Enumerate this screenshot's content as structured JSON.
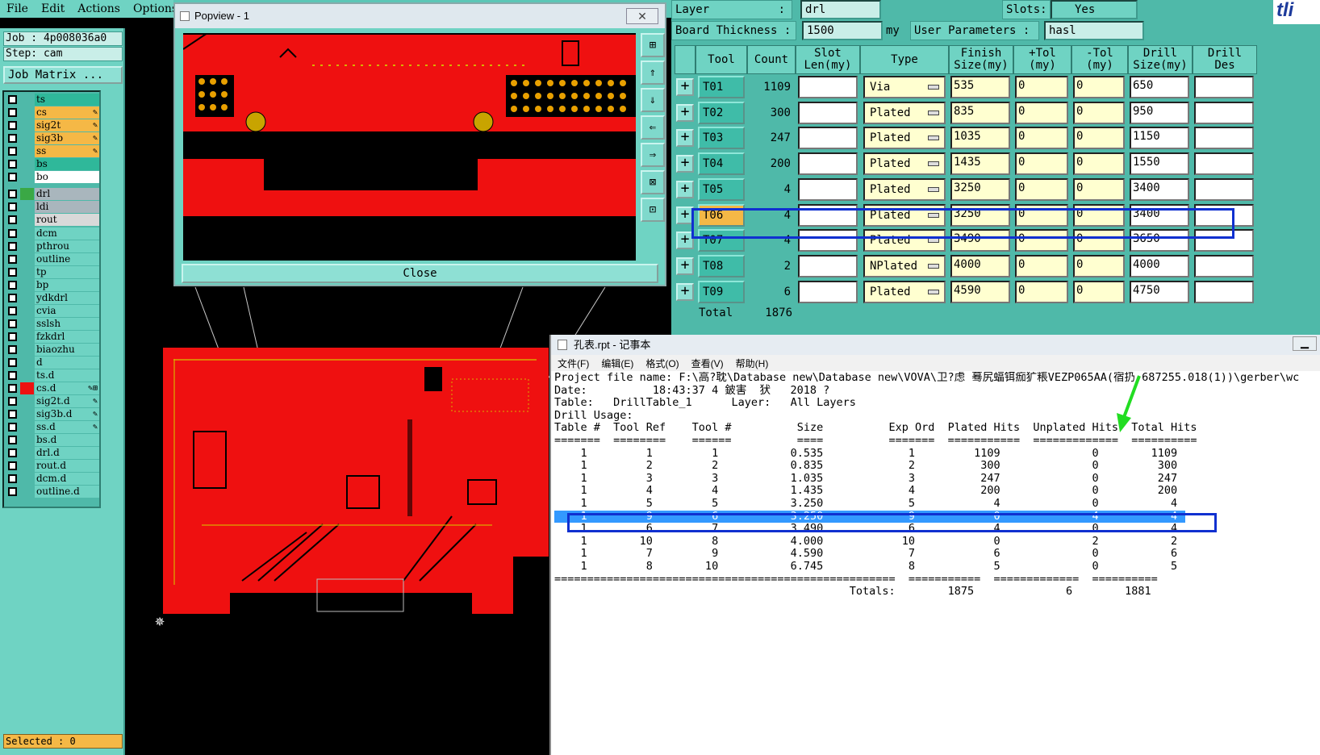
{
  "menubar": {
    "items": [
      "File",
      "Edit",
      "Actions",
      "Options"
    ]
  },
  "leftpanel": {
    "job": "Job : 4p008036a0",
    "step": "Step: cam",
    "job_matrix": "Job Matrix ...",
    "selected": "Selected : 0",
    "layers": [
      {
        "name": "ts",
        "color": "#2fb89a",
        "swatch": "#4fb9a9",
        "mark": ""
      },
      {
        "name": "cs",
        "color": "#f5b846",
        "swatch": "#4fb9a9",
        "mark": "✎"
      },
      {
        "name": "sig2t",
        "color": "#f5b846",
        "swatch": "#4fb9a9",
        "mark": "✎"
      },
      {
        "name": "sig3b",
        "color": "#f5b846",
        "swatch": "#4fb9a9",
        "mark": "✎"
      },
      {
        "name": "ss",
        "color": "#f5b846",
        "swatch": "#4fb9a9",
        "mark": "✎"
      },
      {
        "name": "bs",
        "color": "#2fb89a",
        "swatch": "#4fb9a9",
        "mark": ""
      },
      {
        "name": "bo",
        "color": "#ffffff",
        "swatch": "#4fb9a9",
        "mark": ""
      },
      {
        "name": "drl",
        "color": "#a9b6bd",
        "swatch": "#3aa845",
        "mark": ""
      },
      {
        "name": "ldi",
        "color": "#a9b6bd",
        "swatch": "#4fb9a9",
        "mark": ""
      },
      {
        "name": "rout",
        "color": "#d9d9d9",
        "swatch": "#4fb9a9",
        "mark": ""
      },
      {
        "name": "dcm",
        "color": "#6fd3c3",
        "swatch": "#4fb9a9",
        "mark": ""
      },
      {
        "name": "pthrou",
        "color": "#6fd3c3",
        "swatch": "#4fb9a9",
        "mark": ""
      },
      {
        "name": "outline",
        "color": "#6fd3c3",
        "swatch": "#4fb9a9",
        "mark": ""
      },
      {
        "name": "tp",
        "color": "#6fd3c3",
        "swatch": "#4fb9a9",
        "mark": ""
      },
      {
        "name": "bp",
        "color": "#6fd3c3",
        "swatch": "#4fb9a9",
        "mark": ""
      },
      {
        "name": "ydkdrl",
        "color": "#6fd3c3",
        "swatch": "#4fb9a9",
        "mark": ""
      },
      {
        "name": "cvia",
        "color": "#6fd3c3",
        "swatch": "#4fb9a9",
        "mark": ""
      },
      {
        "name": "sslsh",
        "color": "#6fd3c3",
        "swatch": "#4fb9a9",
        "mark": ""
      },
      {
        "name": "fzkdrl",
        "color": "#6fd3c3",
        "swatch": "#4fb9a9",
        "mark": ""
      },
      {
        "name": "biaozhu",
        "color": "#6fd3c3",
        "swatch": "#4fb9a9",
        "mark": ""
      },
      {
        "name": "d",
        "color": "#6fd3c3",
        "swatch": "#4fb9a9",
        "mark": ""
      },
      {
        "name": "ts.d",
        "color": "#6fd3c3",
        "swatch": "#4fb9a9",
        "mark": ""
      },
      {
        "name": "cs.d",
        "color": "#6fd3c3",
        "swatch": "#ee1111",
        "mark": "✎⊞"
      },
      {
        "name": "sig2t.d",
        "color": "#6fd3c3",
        "swatch": "#4fb9a9",
        "mark": "✎"
      },
      {
        "name": "sig3b.d",
        "color": "#6fd3c3",
        "swatch": "#4fb9a9",
        "mark": "✎"
      },
      {
        "name": "ss.d",
        "color": "#6fd3c3",
        "swatch": "#4fb9a9",
        "mark": "✎"
      },
      {
        "name": "bs.d",
        "color": "#6fd3c3",
        "swatch": "#4fb9a9",
        "mark": ""
      },
      {
        "name": "drl.d",
        "color": "#6fd3c3",
        "swatch": "#4fb9a9",
        "mark": ""
      },
      {
        "name": "rout.d",
        "color": "#6fd3c3",
        "swatch": "#4fb9a9",
        "mark": ""
      },
      {
        "name": "dcm.d",
        "color": "#6fd3c3",
        "swatch": "#4fb9a9",
        "mark": ""
      },
      {
        "name": "outline.d",
        "color": "#6fd3c3",
        "swatch": "#4fb9a9",
        "mark": ""
      }
    ]
  },
  "popview": {
    "title": "Popview - 1",
    "close_x": "✕",
    "close_button": "Close"
  },
  "drill": {
    "layer_label": "Layer",
    "layer_colon": ":",
    "layer_value": "drl",
    "slots_label": "Slots:",
    "slots_value": "Yes",
    "thickness_label": "Board Thickness :",
    "thickness_value": "1500",
    "thickness_unit": "my",
    "userparams_label": "User Parameters :",
    "userparams_value": "hasl",
    "brand": "tli",
    "columns": [
      "Tool",
      "Count",
      "Slot\nLen(my)",
      "Type",
      "Finish\nSize(my)",
      "+Tol\n(my)",
      "-Tol\n(my)",
      "Drill\nSize(my)",
      "Drill\nDes"
    ],
    "rows": [
      {
        "tool": "T01",
        "count": "1109",
        "slot": "",
        "type": "Via",
        "finish": "535",
        "ptol": "0",
        "mtol": "0",
        "drill": "650",
        "des": ""
      },
      {
        "tool": "T02",
        "count": "300",
        "slot": "",
        "type": "Plated",
        "finish": "835",
        "ptol": "0",
        "mtol": "0",
        "drill": "950",
        "des": ""
      },
      {
        "tool": "T03",
        "count": "247",
        "slot": "",
        "type": "Plated",
        "finish": "1035",
        "ptol": "0",
        "mtol": "0",
        "drill": "1150",
        "des": ""
      },
      {
        "tool": "T04",
        "count": "200",
        "slot": "",
        "type": "Plated",
        "finish": "1435",
        "ptol": "0",
        "mtol": "0",
        "drill": "1550",
        "des": ""
      },
      {
        "tool": "T05",
        "count": "4",
        "slot": "",
        "type": "Plated",
        "finish": "3250",
        "ptol": "0",
        "mtol": "0",
        "drill": "3400",
        "des": ""
      },
      {
        "tool": "T06",
        "count": "4",
        "slot": "",
        "type": "Plated",
        "finish": "3250",
        "ptol": "0",
        "mtol": "0",
        "drill": "3400",
        "des": ""
      },
      {
        "tool": "T07",
        "count": "4",
        "slot": "",
        "type": "Plated",
        "finish": "3490",
        "ptol": "0",
        "mtol": "0",
        "drill": "3650",
        "des": ""
      },
      {
        "tool": "T08",
        "count": "2",
        "slot": "",
        "type": "NPlated",
        "finish": "4000",
        "ptol": "0",
        "mtol": "0",
        "drill": "4000",
        "des": ""
      },
      {
        "tool": "T09",
        "count": "6",
        "slot": "",
        "type": "Plated",
        "finish": "4590",
        "ptol": "0",
        "mtol": "0",
        "drill": "4750",
        "des": ""
      }
    ],
    "total_label": "Total",
    "total_value": "1876"
  },
  "notepad": {
    "title": "孔表.rpt - 记事本",
    "menu": [
      "文件(F)",
      "编辑(E)",
      "格式(O)",
      "查看(V)",
      "帮助(H)"
    ],
    "lines": [
      "Project file name: F:\\高?耽\\Database new\\Database new\\VOVA\\卫?虑 蓦尻蝠铒痂犷粻VEZP065AA(宿扔.687255.018(1))\\gerber\\wc",
      "Date:          18:43:37 4 鈹害  犾   2018 ?",
      "Table:   DrillTable_1      Layer:   All Layers",
      "Drill Usage:",
      "Table #  Tool Ref    Tool #          Size          Exp Ord  Plated Hits  Unplated Hits  Total Hits",
      "=======  ========    ======          ====          =======  ===========  =============  ==========",
      "    1         1         1           0.535             1         1109              0        1109",
      "    1         2         2           0.835             2          300              0         300",
      "    1         3         3           1.035             3          247              0         247",
      "    1         4         4           1.435             4          200              0         200",
      "    1         5         5           3.250             5            4              0           4",
      "    1         9         6           3.250             9            0              4           4",
      "    1         6         7           3.490             6            4              0           4",
      "    1        10         8           4.000            10            0              2           2",
      "    1         7         9           4.590             7            6              0           6",
      "    1         8        10           6.745             8            5              0           5",
      "====================================================  ===========  =============  ==========",
      "                                             Totals:        1875              6        1881"
    ],
    "highlight_line": 11
  }
}
